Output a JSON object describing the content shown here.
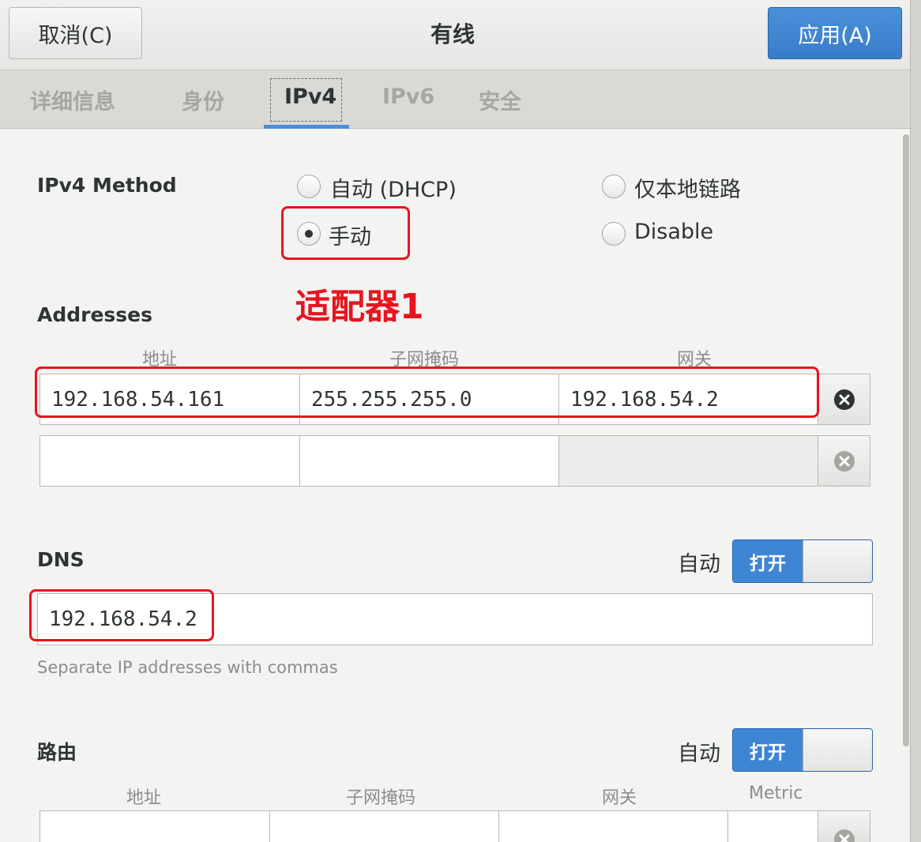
{
  "header": {
    "cancel_label": "取消(C)",
    "title": "有线",
    "apply_label": "应用(A)"
  },
  "tabs": [
    {
      "label": "详细信息"
    },
    {
      "label": "身份"
    },
    {
      "label": "IPv4"
    },
    {
      "label": "IPv6"
    },
    {
      "label": "安全"
    }
  ],
  "ipv4_method": {
    "label": "IPv4 Method",
    "options": [
      {
        "label": "自动 (DHCP)",
        "checked": false
      },
      {
        "label": "仅本地链路",
        "checked": false
      },
      {
        "label": "手动",
        "checked": true
      },
      {
        "label": "Disable",
        "checked": false
      }
    ]
  },
  "annotation": {
    "text": "适配器1",
    "color": "#e8141e"
  },
  "addresses": {
    "label": "Addresses",
    "columns": [
      "地址",
      "子网掩码",
      "网关"
    ],
    "rows": [
      {
        "address": "192.168.54.161",
        "netmask": "255.255.255.0",
        "gateway": "192.168.54.2"
      },
      {
        "address": "",
        "netmask": "",
        "gateway": ""
      }
    ]
  },
  "dns": {
    "label": "DNS",
    "auto_label": "自动",
    "switch_label": "打开",
    "value": "192.168.54.2",
    "hint": "Separate IP addresses with commas"
  },
  "routes": {
    "label": "路由",
    "auto_label": "自动",
    "switch_label": "打开",
    "columns": [
      "地址",
      "子网掩码",
      "网关",
      "Metric"
    ]
  },
  "colors": {
    "accent": "#4a90d9",
    "annotation": "#e8141e"
  }
}
